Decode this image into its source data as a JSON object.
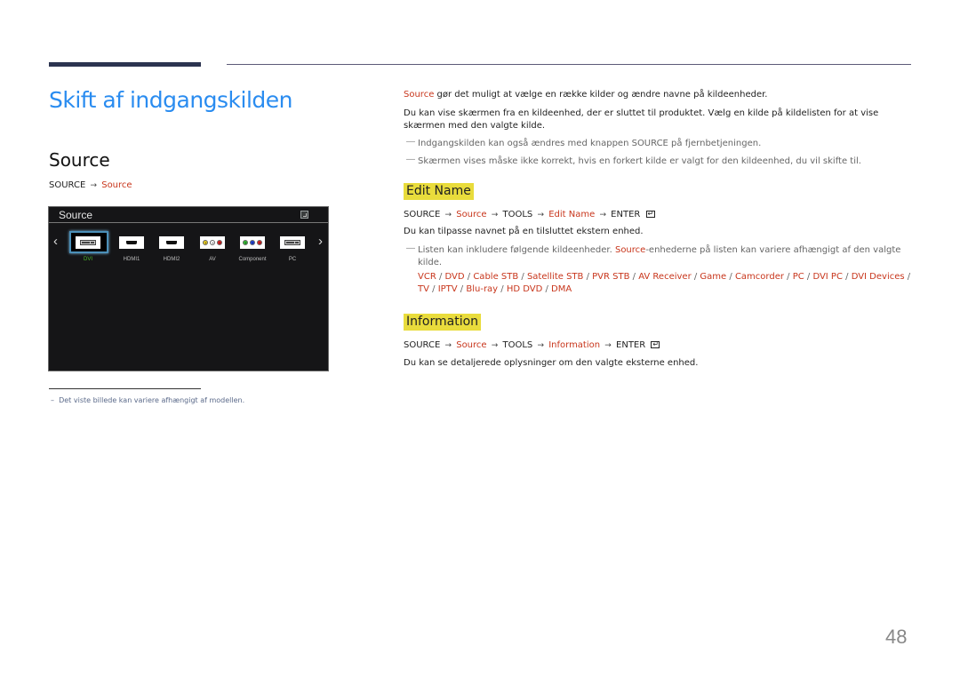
{
  "page": {
    "title": "Skift af indgangskilden",
    "section_title": "Source",
    "page_number": "48"
  },
  "nav_path": {
    "root": "SOURCE",
    "arrow": "→",
    "target": "Source"
  },
  "tv_panel": {
    "title": "Source",
    "icon": "tools-icon",
    "prev_label": "‹",
    "next_label": "›",
    "sources": [
      {
        "label": "DVI",
        "icon": "dvi-port-icon",
        "selected": true
      },
      {
        "label": "HDMI1",
        "icon": "hdmi-port-icon",
        "selected": false
      },
      {
        "label": "HDMI2",
        "icon": "hdmi-port-icon",
        "selected": false
      },
      {
        "label": "AV",
        "icon": "rca-av-icon",
        "selected": false
      },
      {
        "label": "Component",
        "icon": "rca-component-icon",
        "selected": false
      },
      {
        "label": "PC",
        "icon": "pc-port-icon",
        "selected": false
      }
    ],
    "selected_label_color": "#4cbb2a",
    "focus_border_color": "#4b8fb8"
  },
  "footnote": {
    "dash": "–",
    "text": "Det viste billede kan variere afhængigt af modellen."
  },
  "intro": {
    "source_word": "Source",
    "line1_rest": " gør det muligt at vælge en række kilder og ændre navne på kildeenheder.",
    "line2": "Du kan vise skærmen fra en kildeenhed, der er sluttet til produktet. Vælg en kilde på kildelisten for at vise skærmen med den valgte kilde.",
    "note1": "Indgangskilden kan også ændres med knappen SOURCE på fjernbetjeningen.",
    "note2": "Skærmen vises måske ikke korrekt, hvis en forkert kilde er valgt for den kildeenhed, du vil skifte til.",
    "note_dash": "―"
  },
  "edit_name": {
    "heading": "Edit Name",
    "path": {
      "p1": "SOURCE",
      "p2": "Source",
      "p3": "TOOLS",
      "p4": "Edit Name",
      "p5": "ENTER",
      "arrow": "→"
    },
    "description": "Du kan tilpasse navnet på en tilsluttet ekstern enhed.",
    "note_start": "Listen kan inkludere følgende kildeenheder. ",
    "note_source": "Source",
    "note_end": "-enhederne på listen kan variere afhængigt af den valgte kilde.",
    "devices": [
      "VCR",
      "DVD",
      "Cable STB",
      "Satellite STB",
      "PVR STB",
      "AV Receiver",
      "Game",
      "Camcorder",
      "PC",
      "DVI PC",
      "DVI Devices",
      "TV",
      "IPTV",
      "Blu-ray",
      "HD DVD",
      "DMA"
    ],
    "separator": " / "
  },
  "information": {
    "heading": "Information",
    "path": {
      "p1": "SOURCE",
      "p2": "Source",
      "p3": "TOOLS",
      "p4": "Information",
      "p5": "ENTER",
      "arrow": "→"
    },
    "description": "Du kan se detaljerede oplysninger om den valgte eksterne enhed."
  },
  "colors": {
    "title_blue": "#2a8cf0",
    "accent_red": "#c8361c",
    "highlight_yellow": "#e9dc3c",
    "top_bar": "#2c3450"
  }
}
